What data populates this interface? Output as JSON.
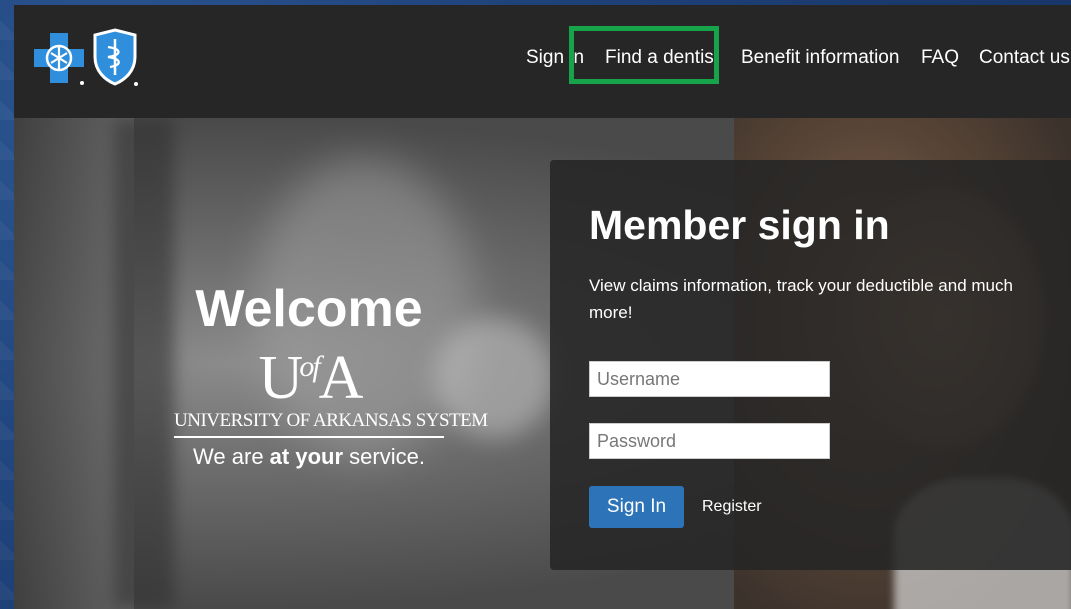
{
  "header": {
    "nav": [
      {
        "label": "Sign in"
      },
      {
        "label": "Find a dentist"
      },
      {
        "label": "Benefit information"
      },
      {
        "label": "FAQ"
      },
      {
        "label": "Contact us"
      }
    ],
    "logos": [
      "bluecross-icon",
      "blueshield-icon"
    ]
  },
  "welcome": {
    "title": "Welcome",
    "uofa_main": "U",
    "uofa_of": "of",
    "uofa_end": "A",
    "system": "UNIVERSITY OF ARKANSAS SYSTEM",
    "service_pre": "We are ",
    "service_bold": "at your",
    "service_post": " service."
  },
  "signin": {
    "title": "Member sign in",
    "description": "View claims information, track your deductible and much more!",
    "username_placeholder": "Username",
    "password_placeholder": "Password",
    "button": "Sign In",
    "register": "Register"
  },
  "colors": {
    "brand_blue": "#2c73b8",
    "highlight_green": "#17a34a",
    "header_bg": "#262626"
  }
}
